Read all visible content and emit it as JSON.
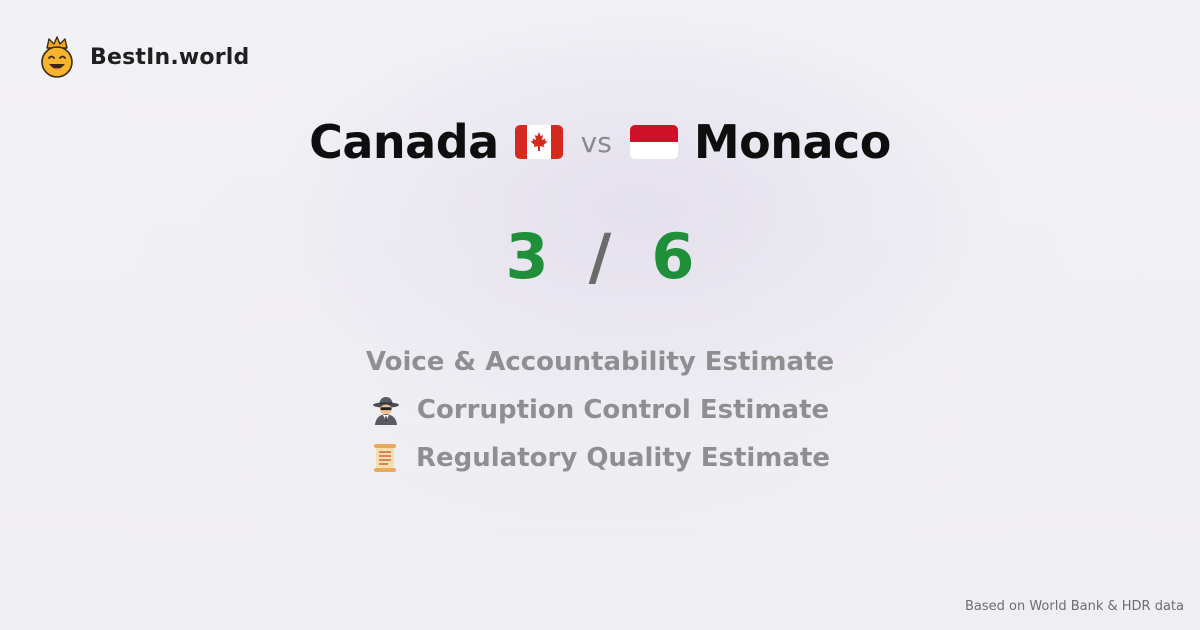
{
  "brand": {
    "name": "BestIn.world",
    "icon": "smiling-crown-face-icon"
  },
  "comparison": {
    "left": {
      "name": "Canada",
      "flag": "canada-flag-icon"
    },
    "vs_label": "vs",
    "right": {
      "name": "Monaco",
      "flag": "monaco-flag-icon"
    }
  },
  "score": {
    "left": "3",
    "separator": "/",
    "right": "6",
    "color": "#1f8f3a"
  },
  "metrics": [
    {
      "icon": "",
      "label": "Voice & Accountability Estimate"
    },
    {
      "icon": "spy-icon",
      "label": "Corruption Control Estimate"
    },
    {
      "icon": "scroll-icon",
      "label": "Regulatory Quality Estimate"
    }
  ],
  "footer": {
    "source": "Based on World Bank & HDR data"
  }
}
